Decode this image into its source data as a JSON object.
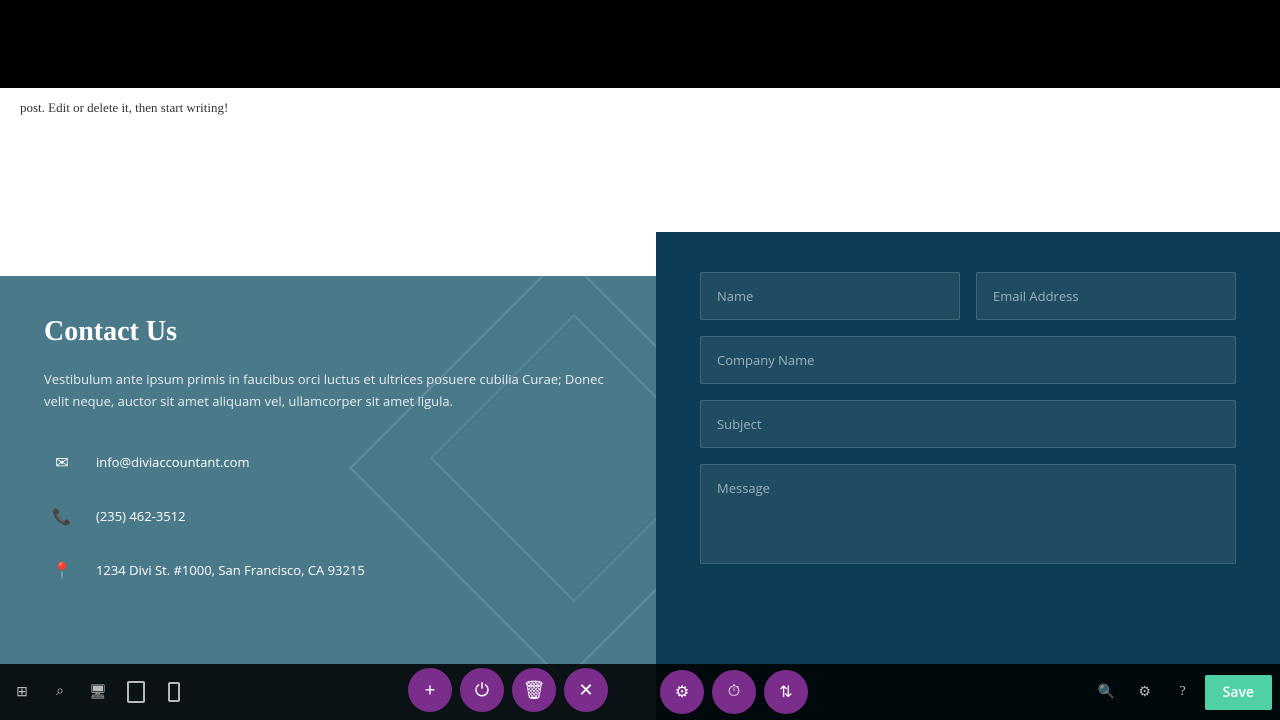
{
  "topBar": {},
  "mainContent": {
    "text": "post. Edit or delete it, then start writing!"
  },
  "contactSection": {
    "heading": "Contact Us",
    "description": "Vestibulum ante ipsum primis in faucibus orci luctus et ultrices posuere cubilia Curae; Donec velit neque, auctor sit amet aliquam vel, ullamcorper sit amet ligula.",
    "email": "info@diviaccountant.com",
    "phone": "(235) 462-3512",
    "address": "1234 Divi St. #1000, San Francisco, CA 93215"
  },
  "contactForm": {
    "namePlaceholder": "Name",
    "emailPlaceholder": "Email Address",
    "companyPlaceholder": "Company Name",
    "subjectPlaceholder": "Subject",
    "messagePlaceholder": "Message"
  },
  "toolbar": {
    "addLabel": "+",
    "saveLabel": "Save",
    "icons": {
      "grid": "⊞",
      "search": "⌕",
      "desktop": "🖥",
      "tablet": "⬜",
      "mobile": "📱",
      "settings": "⚙",
      "clock": "⏱",
      "sort": "⇅",
      "search2": "🔍",
      "options": "⚙",
      "help": "?"
    }
  }
}
